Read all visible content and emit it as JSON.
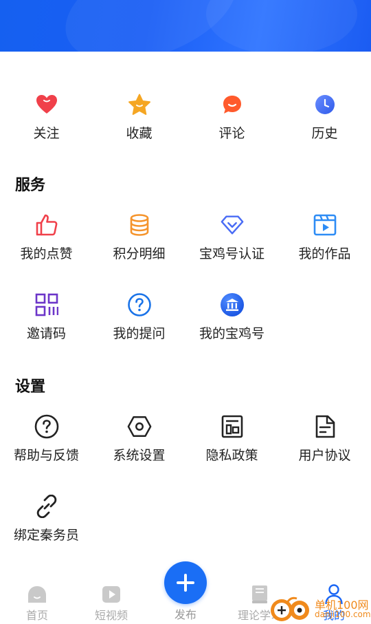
{
  "quick_actions": [
    {
      "label": "关注",
      "icon": "heart-icon",
      "color": "#f0404a"
    },
    {
      "label": "收藏",
      "icon": "star-icon",
      "color": "#f5a623"
    },
    {
      "label": "评论",
      "icon": "comment-icon",
      "color": "#ff5a2c"
    },
    {
      "label": "历史",
      "icon": "clock-icon",
      "color": "#3d6cf5"
    }
  ],
  "services": {
    "title": "服务",
    "items": [
      {
        "label": "我的点赞",
        "icon": "thumbs-up-icon",
        "color": "#f0404a"
      },
      {
        "label": "积分明细",
        "icon": "coins-icon",
        "color": "#f5942c"
      },
      {
        "label": "宝鸡号认证",
        "icon": "diamond-icon",
        "color": "#4a6cf5"
      },
      {
        "label": "我的作品",
        "icon": "video-icon",
        "color": "#2d8cf5"
      },
      {
        "label": "邀请码",
        "icon": "qr-grid-icon",
        "color": "#6c35c9"
      },
      {
        "label": "我的提问",
        "icon": "question-icon",
        "color": "#1a73e8"
      },
      {
        "label": "我的宝鸡号",
        "icon": "building-icon",
        "color": "#1a66f5"
      }
    ]
  },
  "settings": {
    "title": "设置",
    "items": [
      {
        "label": "帮助与反馈",
        "icon": "help-icon"
      },
      {
        "label": "系统设置",
        "icon": "settings-hex-icon"
      },
      {
        "label": "隐私政策",
        "icon": "privacy-doc-icon"
      },
      {
        "label": "用户协议",
        "icon": "agreement-doc-icon"
      },
      {
        "label": "绑定秦务员",
        "icon": "link-icon"
      }
    ]
  },
  "tabbar": {
    "items": [
      {
        "label": "首页",
        "icon": "home-icon"
      },
      {
        "label": "短视频",
        "icon": "play-icon"
      },
      {
        "label": "发布",
        "icon": "plus-icon"
      },
      {
        "label": "理论学习",
        "icon": "book-icon"
      },
      {
        "label": "我的",
        "icon": "user-icon",
        "active": true
      }
    ],
    "accent": "#1a66f5"
  },
  "watermark": {
    "line1": "单机100网",
    "line2": "danji100.com"
  }
}
